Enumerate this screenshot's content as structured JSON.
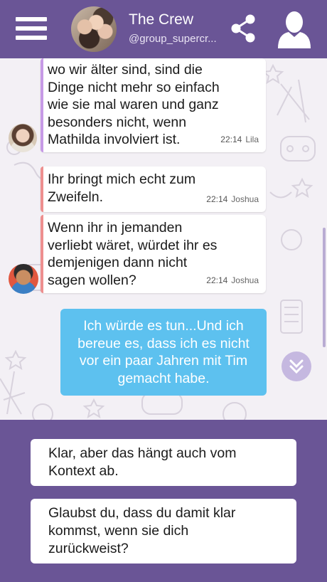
{
  "header": {
    "title": "The Crew",
    "subtitle": "@group_supercr...",
    "menu_icon": "hamburger-menu-icon",
    "share_icon": "share-icon",
    "profile_icon": "profile-icon"
  },
  "colors": {
    "header_bg": "#6a5596",
    "own_bubble": "#5dc1ef",
    "lila_bar": "#c79ae6",
    "joshua_bar": "#ee8f8f",
    "chat_bg": "#f3f0f5"
  },
  "messages": [
    {
      "text": "wo wir älter sind, sind die\nDinge nicht mehr so einfach\nwie sie mal waren und ganz\nbesonders nicht, wenn\nMathilda involviert ist.",
      "time": "22:14",
      "author": "Lila"
    },
    {
      "text": "Ihr bringt mich echt zum\nZweifeln.",
      "time": "22:14",
      "author": "Joshua"
    },
    {
      "text": "Wenn ihr in jemanden\nverliebt wäret, würdet ihr es\ndemjenigen dann nicht\nsagen wollen?",
      "time": "22:14",
      "author": "Joshua"
    }
  ],
  "own_message": {
    "text": "Ich würde es tun...Und ich\nbereue es, dass ich es nicht\nvor ein paar Jahren mit Tim\ngemacht habe."
  },
  "replies": [
    {
      "text": "Klar, aber das hängt auch vom\nKontext ab."
    },
    {
      "text": "Glaubst du, dass du damit klar\nkommst, wenn sie dich\nzurückweist?"
    }
  ]
}
